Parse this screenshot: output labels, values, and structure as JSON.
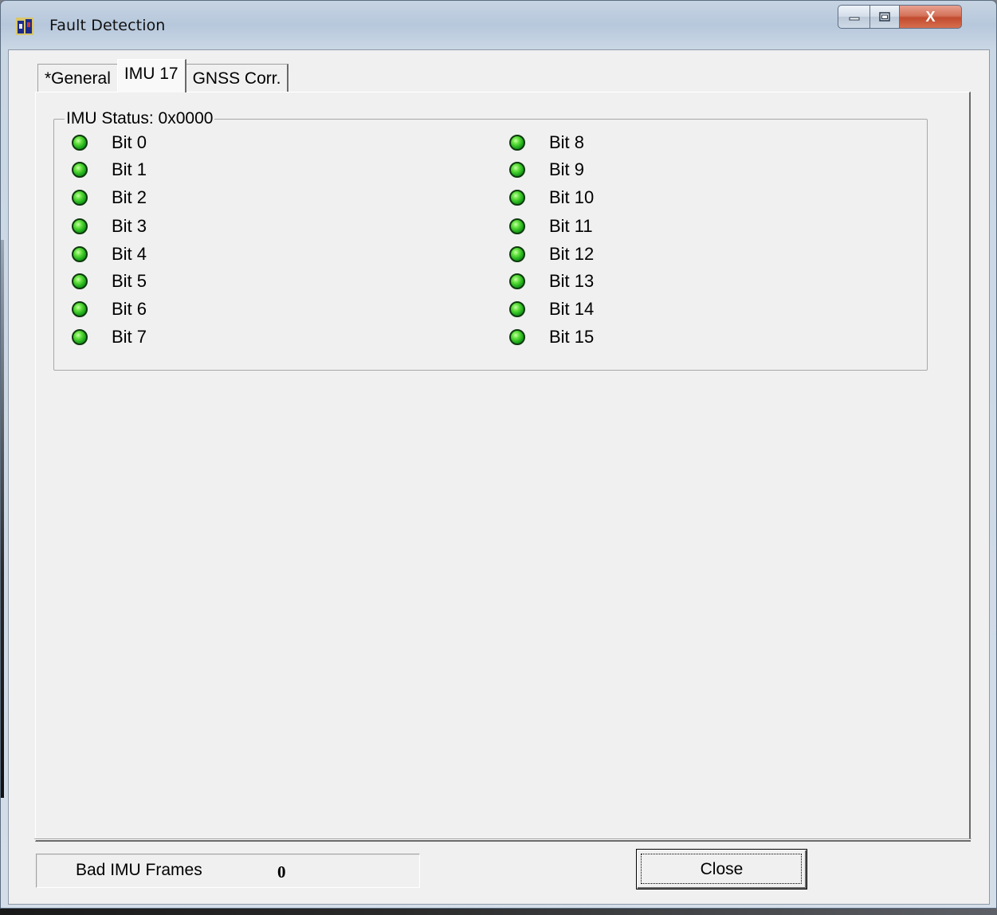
{
  "window": {
    "title": "Fault Detection",
    "controls": {
      "minimize_icon": "minimize-icon",
      "maximize_icon": "maximize-icon",
      "close_label": "X"
    }
  },
  "tabs": [
    {
      "label": "*General",
      "active": false
    },
    {
      "label": "IMU 17",
      "active": true
    },
    {
      "label": "GNSS Corr.",
      "active": false
    }
  ],
  "imu_status": {
    "title": "IMU Status: 0x0000",
    "led_color": "#2bb82b",
    "bits_left": [
      "Bit 0",
      "Bit 1",
      "Bit 2",
      "Bit 3",
      "Bit 4",
      "Bit 5",
      "Bit 6",
      "Bit 7"
    ],
    "bits_right": [
      "Bit 8",
      "Bit 9",
      "Bit 10",
      "Bit 11",
      "Bit 12",
      "Bit 13",
      "Bit 14",
      "Bit 15"
    ]
  },
  "footer": {
    "bad_frames_label": "Bad IMU Frames",
    "bad_frames_value": "0",
    "close_button": "Close"
  }
}
